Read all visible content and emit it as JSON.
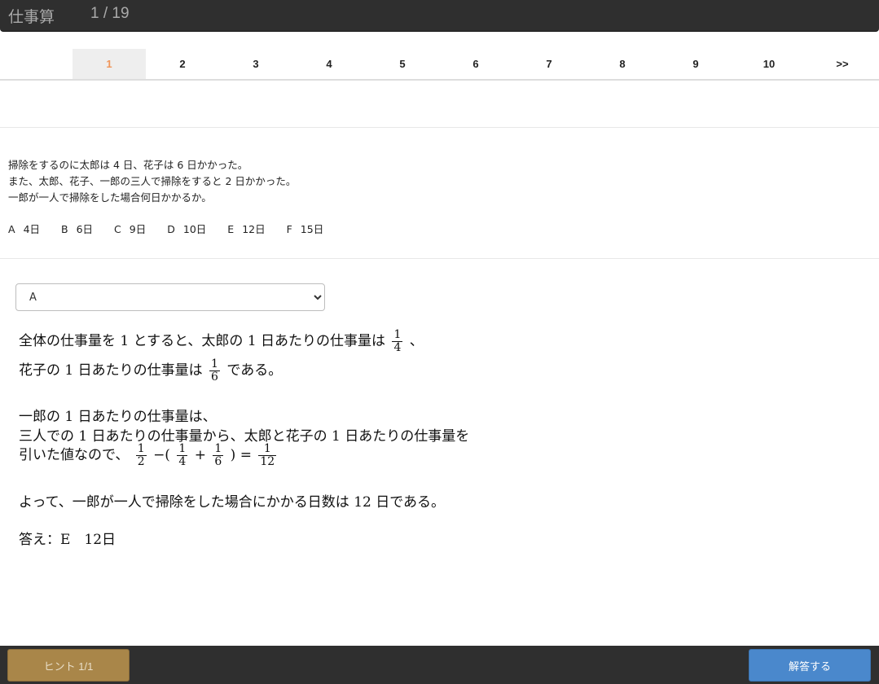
{
  "header": {
    "title": "仕事算",
    "counter": "1 / 19"
  },
  "pager": {
    "pages": [
      "1",
      "2",
      "3",
      "4",
      "5",
      "6",
      "7",
      "8",
      "9",
      "10"
    ],
    "active": "1",
    "next_label": ">>"
  },
  "question": {
    "lines": [
      "掃除をするのに太郎は 4 日、花子は 6 日かかった。",
      "また、太郎、花子、一郎の三人で掃除をすると 2 日かかった。",
      "一郎が一人で掃除をした場合何日かかるか。"
    ],
    "choices": [
      {
        "letter": "A",
        "text": "4日"
      },
      {
        "letter": "B",
        "text": "6日"
      },
      {
        "letter": "C",
        "text": "9日"
      },
      {
        "letter": "D",
        "text": "10日"
      },
      {
        "letter": "E",
        "text": "12日"
      },
      {
        "letter": "F",
        "text": "15日"
      }
    ]
  },
  "answer_select": {
    "selected": "A",
    "options": [
      "A",
      "B",
      "C",
      "D",
      "E",
      "F"
    ]
  },
  "explanation": {
    "l1_pre": "全体の仕事量を 1 とすると、太郎の 1 日あたりの仕事量は",
    "f_taro": {
      "num": "1",
      "den": "4"
    },
    "l1_post": "、",
    "l2_pre": "花子の 1 日あたりの仕事量は",
    "f_hanako": {
      "num": "1",
      "den": "6"
    },
    "l2_post": "である。",
    "l3": "一郎の 1 日あたりの仕事量は、",
    "l4": "三人での 1 日あたりの仕事量から、太郎と花子の 1 日あたりの仕事量を",
    "l5_pre": "引いた値なので、",
    "f_a": {
      "num": "1",
      "den": "2"
    },
    "op_minus_paren": "−(",
    "f_b": {
      "num": "1",
      "den": "4"
    },
    "op_plus": "+",
    "f_c": {
      "num": "1",
      "den": "6"
    },
    "op_close_eq": ") =",
    "f_result": {
      "num": "1",
      "den": "12"
    },
    "l6": "よって、一郎が一人で掃除をした場合にかかる日数は 12 日である。",
    "answer": "答え：E　12日"
  },
  "footer": {
    "hint_label": "ヒント 1/1",
    "answer_label": "解答する"
  },
  "colors": {
    "active_page": "#f0965a",
    "hint_button": "#a98649",
    "answer_button": "#4a88cc",
    "bar": "#2f2f2f"
  }
}
